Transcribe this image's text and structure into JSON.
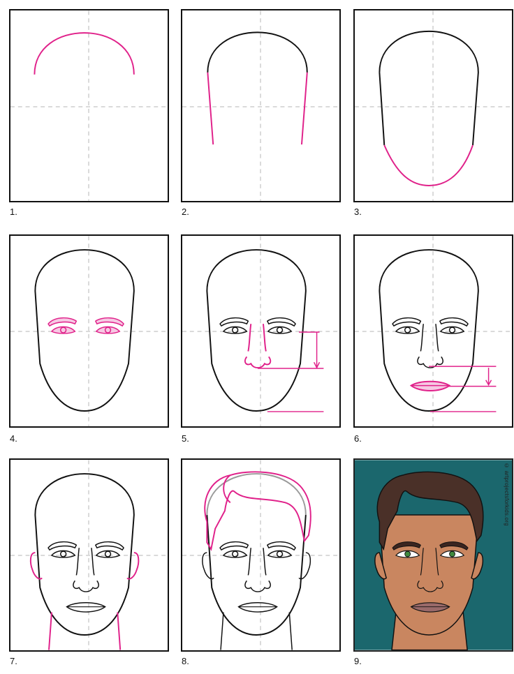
{
  "steps": [
    {
      "label": "1."
    },
    {
      "label": "2."
    },
    {
      "label": "3."
    },
    {
      "label": "4."
    },
    {
      "label": "5."
    },
    {
      "label": "6."
    },
    {
      "label": "7."
    },
    {
      "label": "8."
    },
    {
      "label": "9."
    }
  ],
  "watermark": "© artprojectsforkids.org",
  "colors": {
    "ink": "#111111",
    "new_line": "#e0218a",
    "guide": "#b5b5b5",
    "background_teal": "#1f6f73",
    "skin": "#c98660",
    "hair": "#4a3028",
    "eyes": "#3f8a3f",
    "lips": "#9a6a6a"
  }
}
